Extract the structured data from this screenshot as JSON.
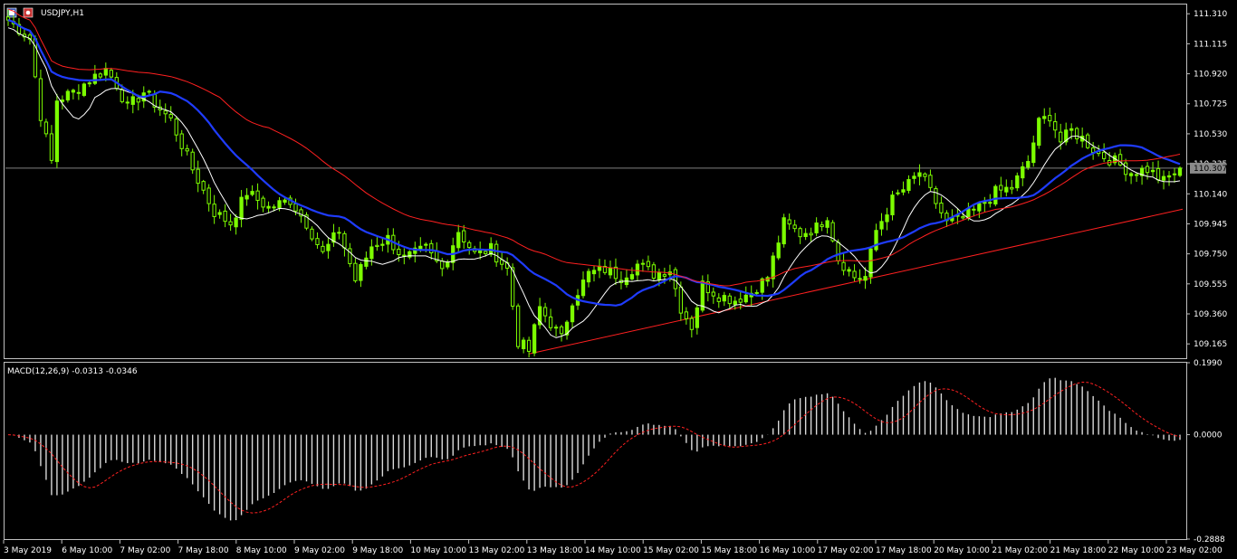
{
  "window": {
    "symbol_title": "USDJPY,H1"
  },
  "colors": {
    "background": "#000000",
    "frame": "#c0c0c0",
    "candle": "#7cfc00",
    "ma_fast": "#ffffff",
    "ma_mid": "#1f3cff",
    "ma_slow": "#ff2020",
    "trendline": "#ff2020",
    "price_line": "#7f7f7f",
    "macd_hist": "#d9d9d9",
    "macd_signal": "#ff2020"
  },
  "chart_data": [
    {
      "type": "candlestick",
      "title": "USDJPY,H1",
      "current_price_label": "110.307",
      "current_price": 110.307,
      "ylim": [
        109.072,
        111.37
      ],
      "yticks": [
        "111.310",
        "111.115",
        "110.920",
        "110.725",
        "110.530",
        "110.335",
        "110.140",
        "109.945",
        "109.750",
        "109.555",
        "109.360",
        "109.165"
      ],
      "x_labels": [
        "3 May 2019",
        "6 May 10:00",
        "7 May 02:00",
        "7 May 18:00",
        "8 May 10:00",
        "9 May 02:00",
        "9 May 18:00",
        "10 May 10:00",
        "13 May 02:00",
        "13 May 18:00",
        "14 May 10:00",
        "15 May 02:00",
        "15 May 18:00",
        "16 May 10:00",
        "17 May 02:00",
        "17 May 18:00",
        "20 May 10:00",
        "21 May 02:00",
        "21 May 18:00",
        "22 May 10:00",
        "23 May 02:00"
      ],
      "bar_count": 217,
      "anchors": [
        {
          "i": 0,
          "p": 111.27
        },
        {
          "i": 4,
          "p": 111.15
        },
        {
          "i": 6,
          "p": 110.65
        },
        {
          "i": 8,
          "p": 110.35
        },
        {
          "i": 9,
          "p": 110.75
        },
        {
          "i": 12,
          "p": 110.8
        },
        {
          "i": 15,
          "p": 110.88
        },
        {
          "i": 18,
          "p": 110.95
        },
        {
          "i": 20,
          "p": 110.85
        },
        {
          "i": 22,
          "p": 110.7
        },
        {
          "i": 25,
          "p": 110.8
        },
        {
          "i": 30,
          "p": 110.62
        },
        {
          "i": 34,
          "p": 110.3
        },
        {
          "i": 38,
          "p": 110.02
        },
        {
          "i": 41,
          "p": 109.95
        },
        {
          "i": 44,
          "p": 110.15
        },
        {
          "i": 48,
          "p": 110.05
        },
        {
          "i": 52,
          "p": 110.1
        },
        {
          "i": 55,
          "p": 109.95
        },
        {
          "i": 58,
          "p": 109.75
        },
        {
          "i": 61,
          "p": 109.9
        },
        {
          "i": 64,
          "p": 109.58
        },
        {
          "i": 67,
          "p": 109.8
        },
        {
          "i": 70,
          "p": 109.85
        },
        {
          "i": 73,
          "p": 109.72
        },
        {
          "i": 77,
          "p": 109.78
        },
        {
          "i": 80,
          "p": 109.65
        },
        {
          "i": 83,
          "p": 109.9
        },
        {
          "i": 86,
          "p": 109.75
        },
        {
          "i": 89,
          "p": 109.78
        },
        {
          "i": 92,
          "p": 109.65
        },
        {
          "i": 94,
          "p": 109.18
        },
        {
          "i": 96,
          "p": 109.12
        },
        {
          "i": 98,
          "p": 109.4
        },
        {
          "i": 100,
          "p": 109.3
        },
        {
          "i": 102,
          "p": 109.2
        },
        {
          "i": 104,
          "p": 109.45
        },
        {
          "i": 107,
          "p": 109.62
        },
        {
          "i": 110,
          "p": 109.65
        },
        {
          "i": 113,
          "p": 109.6
        },
        {
          "i": 116,
          "p": 109.68
        },
        {
          "i": 119,
          "p": 109.62
        },
        {
          "i": 122,
          "p": 109.65
        },
        {
          "i": 124,
          "p": 109.4
        },
        {
          "i": 126,
          "p": 109.28
        },
        {
          "i": 128,
          "p": 109.55
        },
        {
          "i": 131,
          "p": 109.48
        },
        {
          "i": 134,
          "p": 109.45
        },
        {
          "i": 137,
          "p": 109.5
        },
        {
          "i": 140,
          "p": 109.6
        },
        {
          "i": 143,
          "p": 109.95
        },
        {
          "i": 146,
          "p": 109.88
        },
        {
          "i": 149,
          "p": 109.92
        },
        {
          "i": 151,
          "p": 110.0
        },
        {
          "i": 153,
          "p": 109.72
        },
        {
          "i": 156,
          "p": 109.6
        },
        {
          "i": 158,
          "p": 109.6
        },
        {
          "i": 160,
          "p": 109.9
        },
        {
          "i": 163,
          "p": 110.1
        },
        {
          "i": 166,
          "p": 110.2
        },
        {
          "i": 168,
          "p": 110.28
        },
        {
          "i": 170,
          "p": 110.15
        },
        {
          "i": 173,
          "p": 109.95
        },
        {
          "i": 176,
          "p": 109.98
        },
        {
          "i": 179,
          "p": 110.05
        },
        {
          "i": 182,
          "p": 110.15
        },
        {
          "i": 185,
          "p": 110.18
        },
        {
          "i": 188,
          "p": 110.35
        },
        {
          "i": 190,
          "p": 110.6
        },
        {
          "i": 192,
          "p": 110.65
        },
        {
          "i": 194,
          "p": 110.48
        },
        {
          "i": 196,
          "p": 110.55
        },
        {
          "i": 198,
          "p": 110.5
        },
        {
          "i": 201,
          "p": 110.4
        },
        {
          "i": 204,
          "p": 110.35
        },
        {
          "i": 207,
          "p": 110.28
        },
        {
          "i": 210,
          "p": 110.3
        },
        {
          "i": 213,
          "p": 110.22
        },
        {
          "i": 216,
          "p": 110.307
        }
      ],
      "trendline": {
        "start": {
          "i": 96,
          "p": 109.1
        },
        "end": {
          "i": 216,
          "p": 110.04
        }
      },
      "indicators": [
        {
          "name": "ma_fast",
          "period": 8
        },
        {
          "name": "ma_mid",
          "period": 20
        },
        {
          "name": "ma_slow",
          "period": 40
        }
      ]
    },
    {
      "type": "histogram",
      "title": "MACD(12,26,9) -0.0313 -0.0346",
      "ylim": [
        -0.2888,
        0.199
      ],
      "yticks": [
        "0.1990",
        "0.0000",
        "-0.2888"
      ],
      "series": [
        {
          "name": "MACD main (histogram)"
        },
        {
          "name": "Signal (dashed)"
        }
      ],
      "last_values": {
        "macd": -0.0313,
        "signal": -0.0346
      }
    }
  ]
}
